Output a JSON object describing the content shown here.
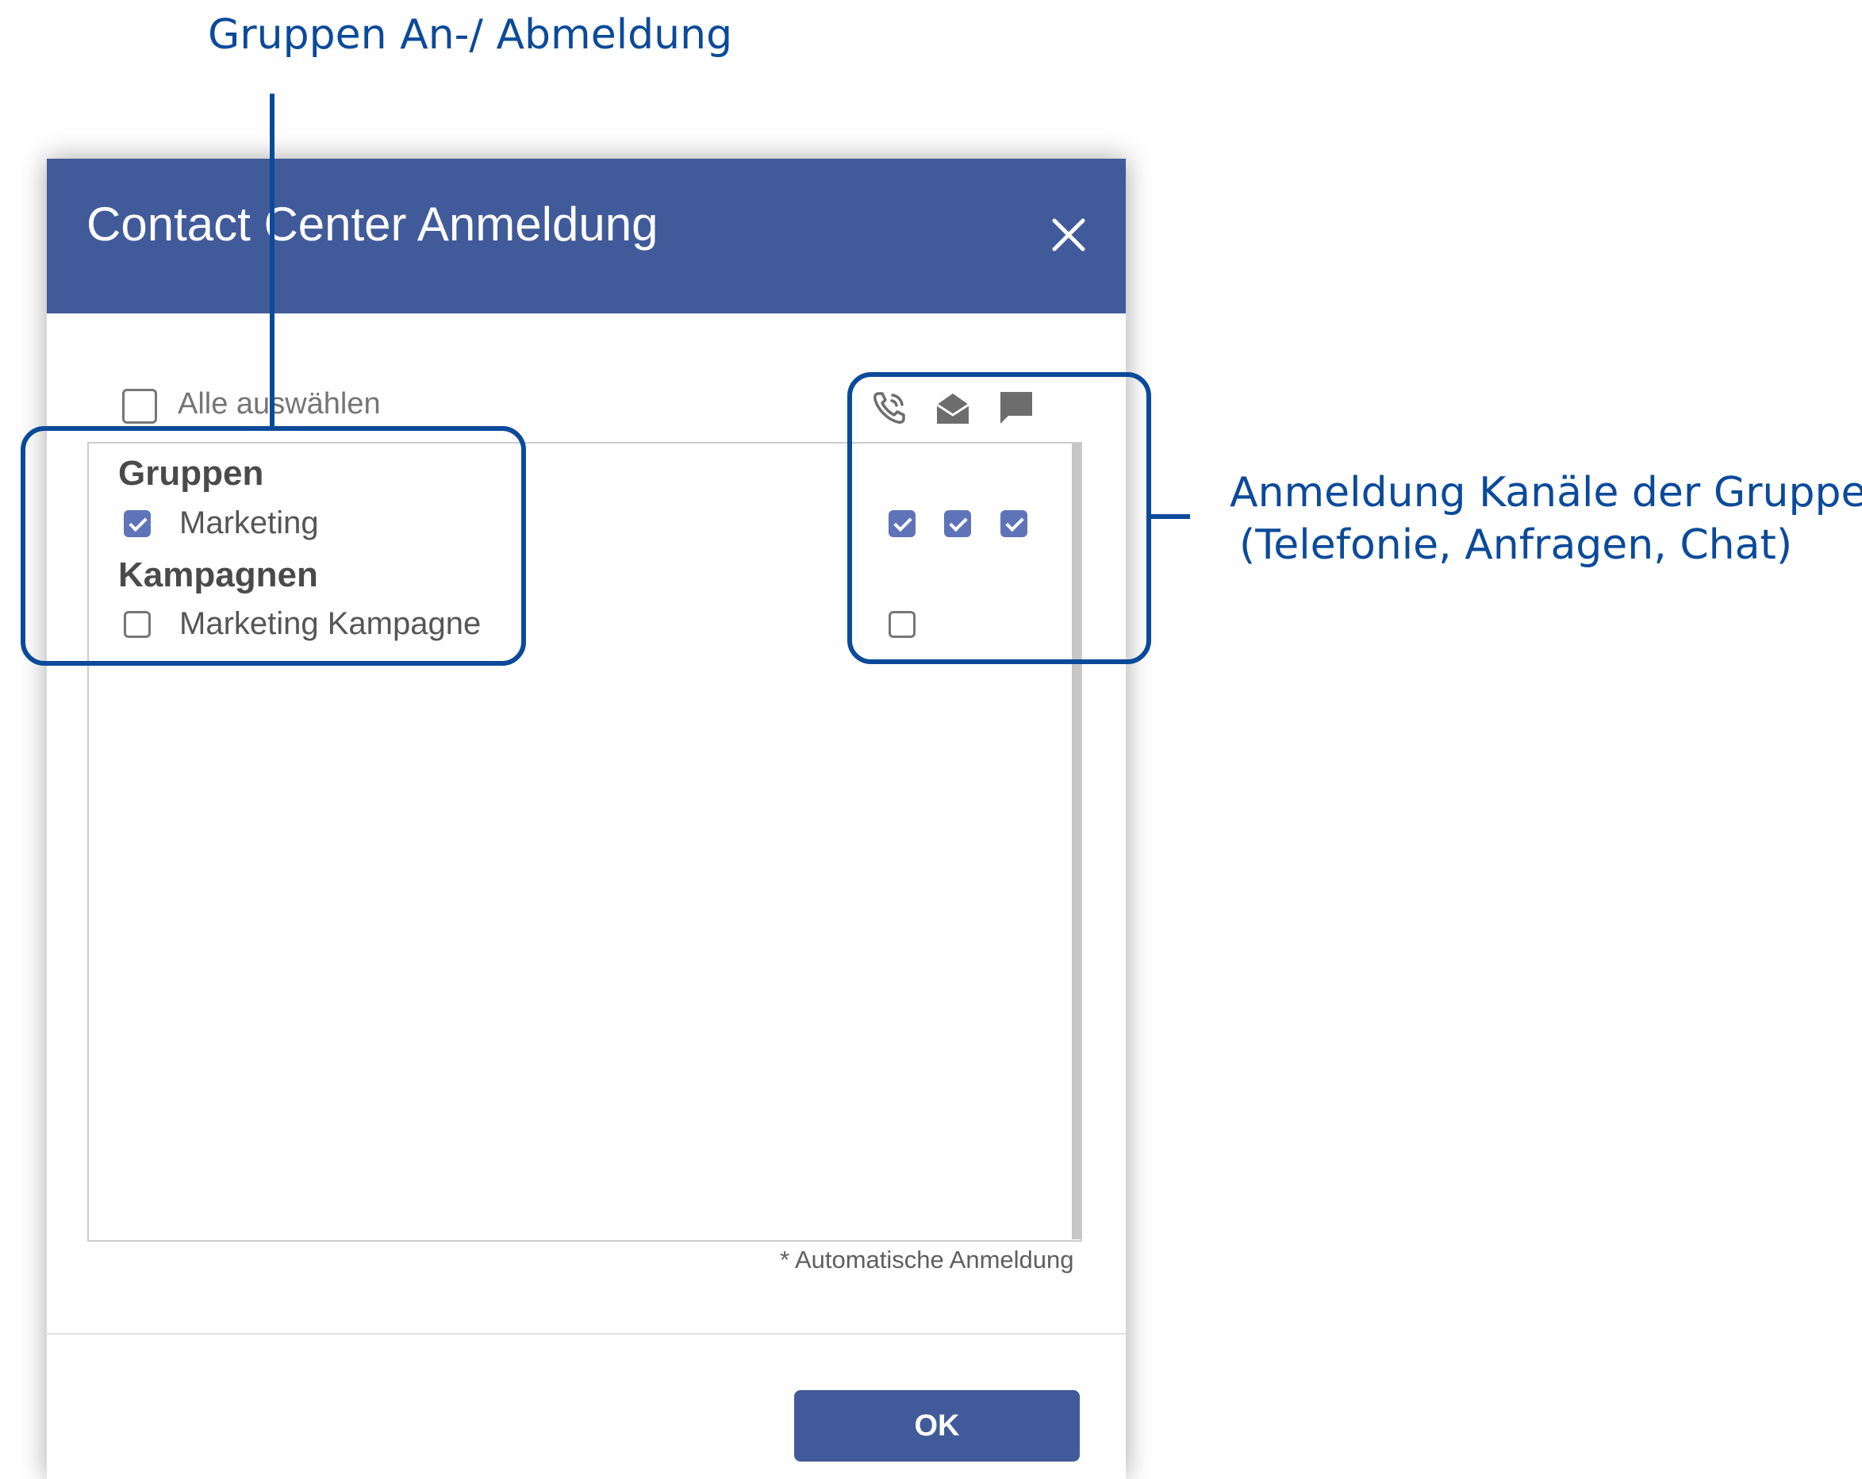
{
  "annotations": {
    "groups_login": "Gruppen An-/ Abmeldung",
    "channels_line1": "Anmeldung Kanäle der Gruppen",
    "channels_line2": "(Telefonie, Anfragen, Chat)",
    "color": "#0b4a9a"
  },
  "dialog": {
    "title": "Contact Center Anmeldung",
    "header_color": "#415a99",
    "close_icon": "close-icon",
    "select_all_label": "Alle auswählen",
    "select_all_checked": false,
    "channel_icons": [
      "phone-icon",
      "envelope-open-icon",
      "chat-bubble-icon"
    ],
    "sections": [
      {
        "title": "Gruppen",
        "items": [
          {
            "label": "Marketing",
            "checked": true,
            "channels": [
              true,
              true,
              true
            ]
          }
        ]
      },
      {
        "title": "Kampagnen",
        "items": [
          {
            "label": "Marketing Kampagne",
            "checked": false,
            "channels": [
              false
            ]
          }
        ]
      }
    ],
    "footnote": "* Automatische Anmeldung",
    "ok_label": "OK"
  }
}
